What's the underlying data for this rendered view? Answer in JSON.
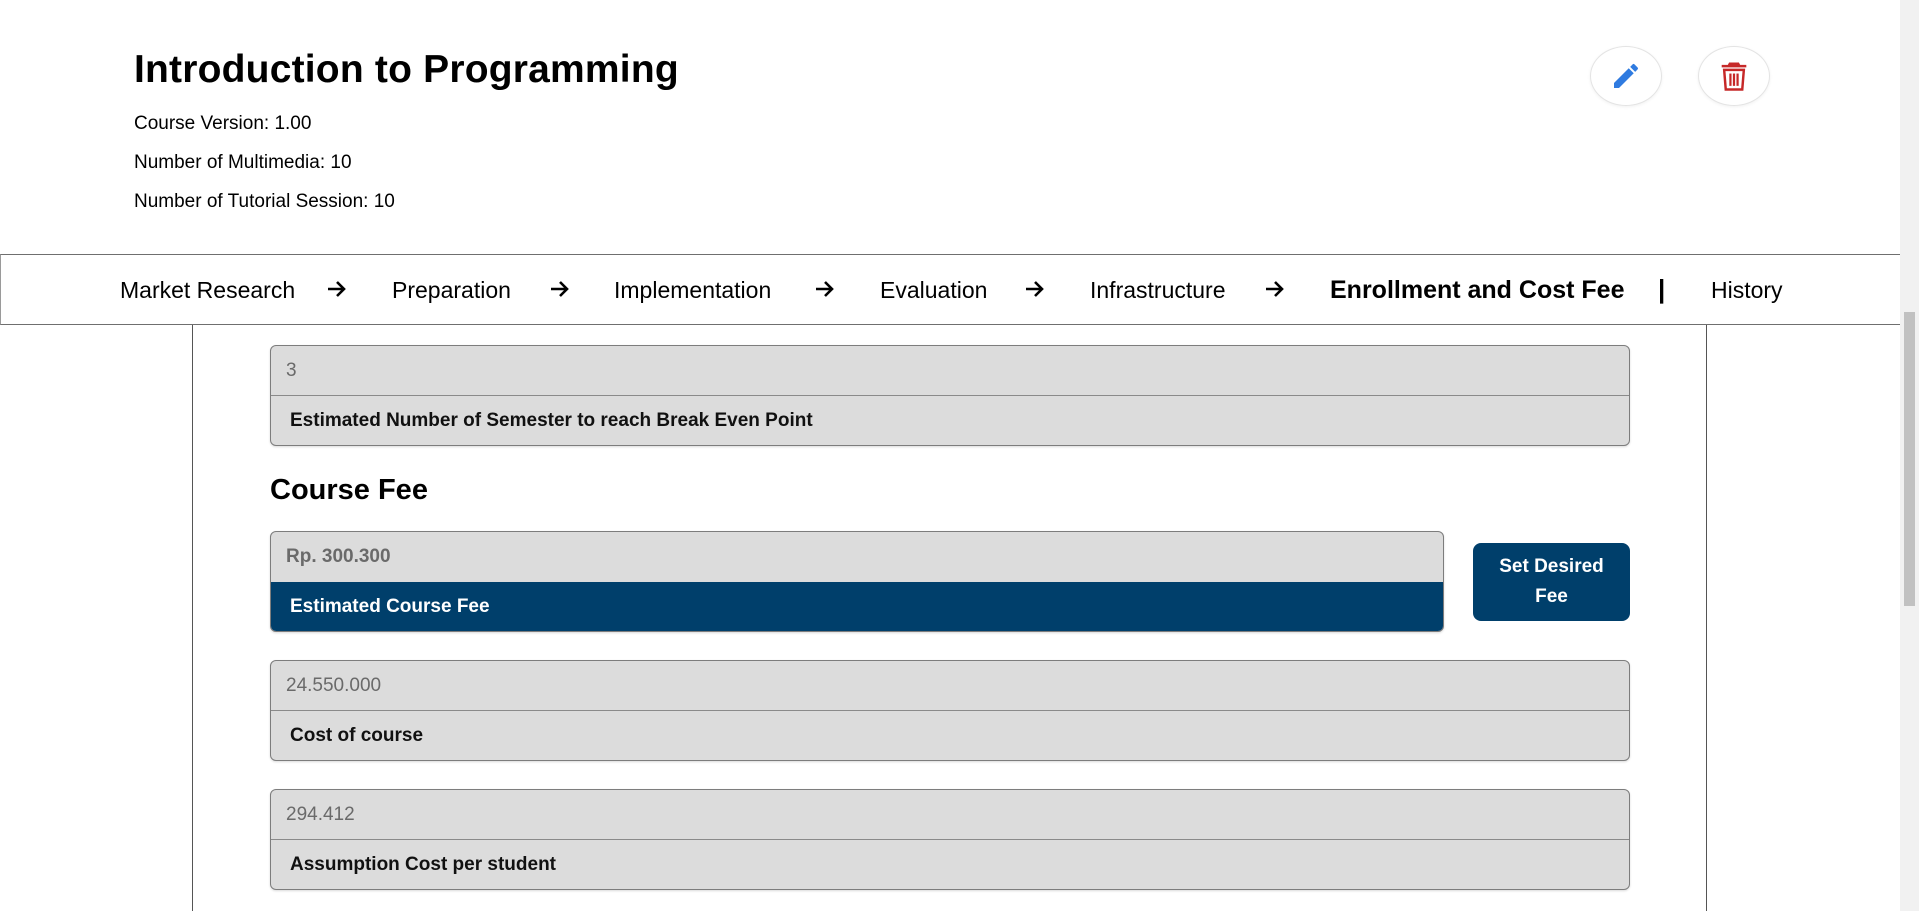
{
  "course": {
    "title": "Introduction to Programming",
    "version": "Course Version: 1.00",
    "multimedia": "Number of Multimedia: 10",
    "tutorial": "Number of Tutorial Session: 10"
  },
  "actions": {
    "edit_icon": "pencil-icon",
    "delete_icon": "trash-icon",
    "edit_color": "#2f7be0",
    "delete_color": "#c62828"
  },
  "nav": {
    "items": [
      "Market Research",
      "Preparation",
      "Implementation",
      "Evaluation",
      "Infrastructure",
      "Enrollment and Cost Fee"
    ],
    "active": "Enrollment and Cost Fee",
    "separator": "|",
    "history": "History"
  },
  "break_even": {
    "value": "3",
    "label": "Estimated Number of Semester to reach Break Even Point"
  },
  "course_fee": {
    "title": "Course Fee",
    "estimated": {
      "value": "Rp. 300.300",
      "label": "Estimated Course Fee"
    },
    "set_desired_button": "Set Desired Fee",
    "cost_of_course": {
      "value": "24.550.000",
      "label": "Cost of course"
    },
    "assumption_cost": {
      "value": "294.412",
      "label": "Assumption Cost per student"
    }
  },
  "colors": {
    "accent": "#003f6b"
  }
}
